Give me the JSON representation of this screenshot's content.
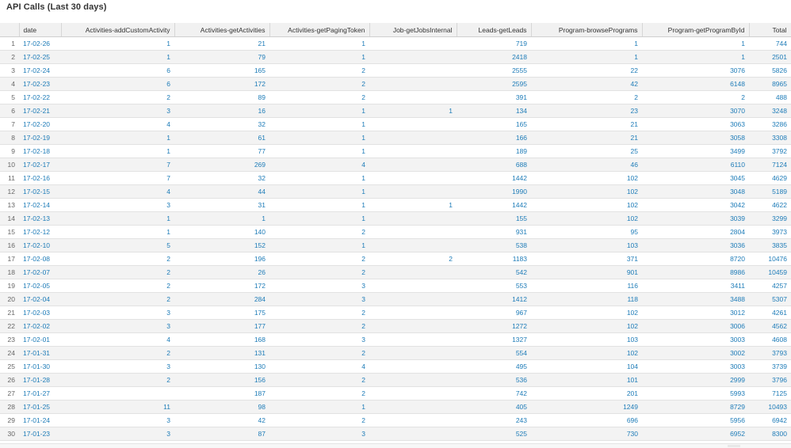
{
  "panel": {
    "title": "API Calls (Last 30 days)"
  },
  "table": {
    "columns": [
      "date",
      "Activities-addCustomActivity",
      "Activities-getActivities",
      "Activities-getPagingToken",
      "Job-getJobsInternal",
      "Leads-getLeads",
      "Program-browsePrograms",
      "Program-getProgramById",
      "Total"
    ],
    "rows": [
      [
        "1",
        "17-02-26",
        "1",
        "21",
        "1",
        "",
        "719",
        "1",
        "1",
        "744"
      ],
      [
        "2",
        "17-02-25",
        "1",
        "79",
        "1",
        "",
        "2418",
        "1",
        "1",
        "2501"
      ],
      [
        "3",
        "17-02-24",
        "6",
        "165",
        "2",
        "",
        "2555",
        "22",
        "3076",
        "5826"
      ],
      [
        "4",
        "17-02-23",
        "6",
        "172",
        "2",
        "",
        "2595",
        "42",
        "6148",
        "8965"
      ],
      [
        "5",
        "17-02-22",
        "2",
        "89",
        "2",
        "",
        "391",
        "2",
        "2",
        "488"
      ],
      [
        "6",
        "17-02-21",
        "3",
        "16",
        "1",
        "1",
        "134",
        "23",
        "3070",
        "3248"
      ],
      [
        "7",
        "17-02-20",
        "4",
        "32",
        "1",
        "",
        "165",
        "21",
        "3063",
        "3286"
      ],
      [
        "8",
        "17-02-19",
        "1",
        "61",
        "1",
        "",
        "166",
        "21",
        "3058",
        "3308"
      ],
      [
        "9",
        "17-02-18",
        "1",
        "77",
        "1",
        "",
        "189",
        "25",
        "3499",
        "3792"
      ],
      [
        "10",
        "17-02-17",
        "7",
        "269",
        "4",
        "",
        "688",
        "46",
        "6110",
        "7124"
      ],
      [
        "11",
        "17-02-16",
        "7",
        "32",
        "1",
        "",
        "1442",
        "102",
        "3045",
        "4629"
      ],
      [
        "12",
        "17-02-15",
        "4",
        "44",
        "1",
        "",
        "1990",
        "102",
        "3048",
        "5189"
      ],
      [
        "13",
        "17-02-14",
        "3",
        "31",
        "1",
        "1",
        "1442",
        "102",
        "3042",
        "4622"
      ],
      [
        "14",
        "17-02-13",
        "1",
        "1",
        "1",
        "",
        "155",
        "102",
        "3039",
        "3299"
      ],
      [
        "15",
        "17-02-12",
        "1",
        "140",
        "2",
        "",
        "931",
        "95",
        "2804",
        "3973"
      ],
      [
        "16",
        "17-02-10",
        "5",
        "152",
        "1",
        "",
        "538",
        "103",
        "3036",
        "3835"
      ],
      [
        "17",
        "17-02-08",
        "2",
        "196",
        "2",
        "2",
        "1183",
        "371",
        "8720",
        "10476"
      ],
      [
        "18",
        "17-02-07",
        "2",
        "26",
        "2",
        "",
        "542",
        "901",
        "8986",
        "10459"
      ],
      [
        "19",
        "17-02-05",
        "2",
        "172",
        "3",
        "",
        "553",
        "116",
        "3411",
        "4257"
      ],
      [
        "20",
        "17-02-04",
        "2",
        "284",
        "3",
        "",
        "1412",
        "118",
        "3488",
        "5307"
      ],
      [
        "21",
        "17-02-03",
        "3",
        "175",
        "2",
        "",
        "967",
        "102",
        "3012",
        "4261"
      ],
      [
        "22",
        "17-02-02",
        "3",
        "177",
        "2",
        "",
        "1272",
        "102",
        "3006",
        "4562"
      ],
      [
        "23",
        "17-02-01",
        "4",
        "168",
        "3",
        "",
        "1327",
        "103",
        "3003",
        "4608"
      ],
      [
        "24",
        "17-01-31",
        "2",
        "131",
        "2",
        "",
        "554",
        "102",
        "3002",
        "3793"
      ],
      [
        "25",
        "17-01-30",
        "3",
        "130",
        "4",
        "",
        "495",
        "104",
        "3003",
        "3739"
      ],
      [
        "26",
        "17-01-28",
        "2",
        "156",
        "2",
        "",
        "536",
        "101",
        "2999",
        "3796"
      ],
      [
        "27",
        "17-01-27",
        "",
        "187",
        "2",
        "",
        "742",
        "201",
        "5993",
        "7125"
      ],
      [
        "28",
        "17-01-25",
        "11",
        "98",
        "1",
        "",
        "405",
        "1249",
        "8729",
        "10493"
      ],
      [
        "29",
        "17-01-24",
        "3",
        "42",
        "2",
        "",
        "243",
        "696",
        "5956",
        "6942"
      ],
      [
        "30",
        "17-01-23",
        "3",
        "87",
        "3",
        "",
        "525",
        "730",
        "6952",
        "8300"
      ]
    ]
  },
  "colors": {
    "link": "#1e7cb8",
    "header_bg": "#f1f1f1",
    "stripe": "#f3f3f3"
  }
}
